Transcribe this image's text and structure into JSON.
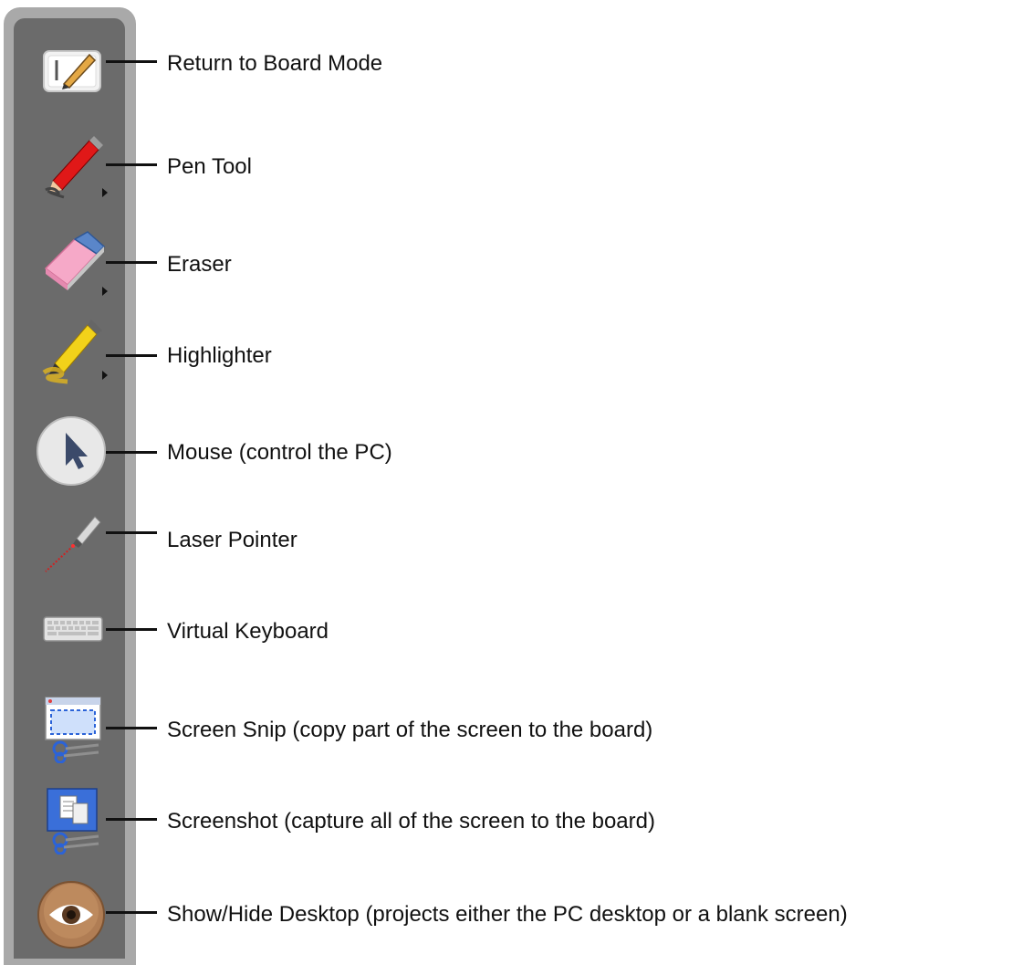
{
  "tools": [
    {
      "id": "board-mode",
      "label": "Return to Board Mode",
      "icon": "board-mode-icon"
    },
    {
      "id": "pen",
      "label": "Pen Tool",
      "icon": "pen-icon",
      "has_submenu": true
    },
    {
      "id": "eraser",
      "label": "Eraser",
      "icon": "eraser-icon",
      "has_submenu": true
    },
    {
      "id": "highlighter",
      "label": "Highlighter",
      "icon": "highlighter-icon",
      "has_submenu": true
    },
    {
      "id": "mouse",
      "label": "Mouse (control the PC)",
      "icon": "mouse-pointer-icon"
    },
    {
      "id": "laser",
      "label": "Laser Pointer",
      "icon": "laser-pointer-icon"
    },
    {
      "id": "keyboard",
      "label": "Virtual Keyboard",
      "icon": "keyboard-icon"
    },
    {
      "id": "screen-snip",
      "label": "Screen Snip (copy part of the screen to the board)",
      "icon": "screen-snip-icon"
    },
    {
      "id": "screenshot",
      "label": "Screenshot (capture all of the screen to the board)",
      "icon": "screenshot-icon"
    },
    {
      "id": "desktop",
      "label": "Show/Hide Desktop (projects either the PC desktop or a blank screen)",
      "icon": "eye-icon"
    }
  ],
  "colors": {
    "toolbar_outer": "#a9a9a9",
    "toolbar_inner": "#6b6b6b",
    "text": "#111111"
  }
}
